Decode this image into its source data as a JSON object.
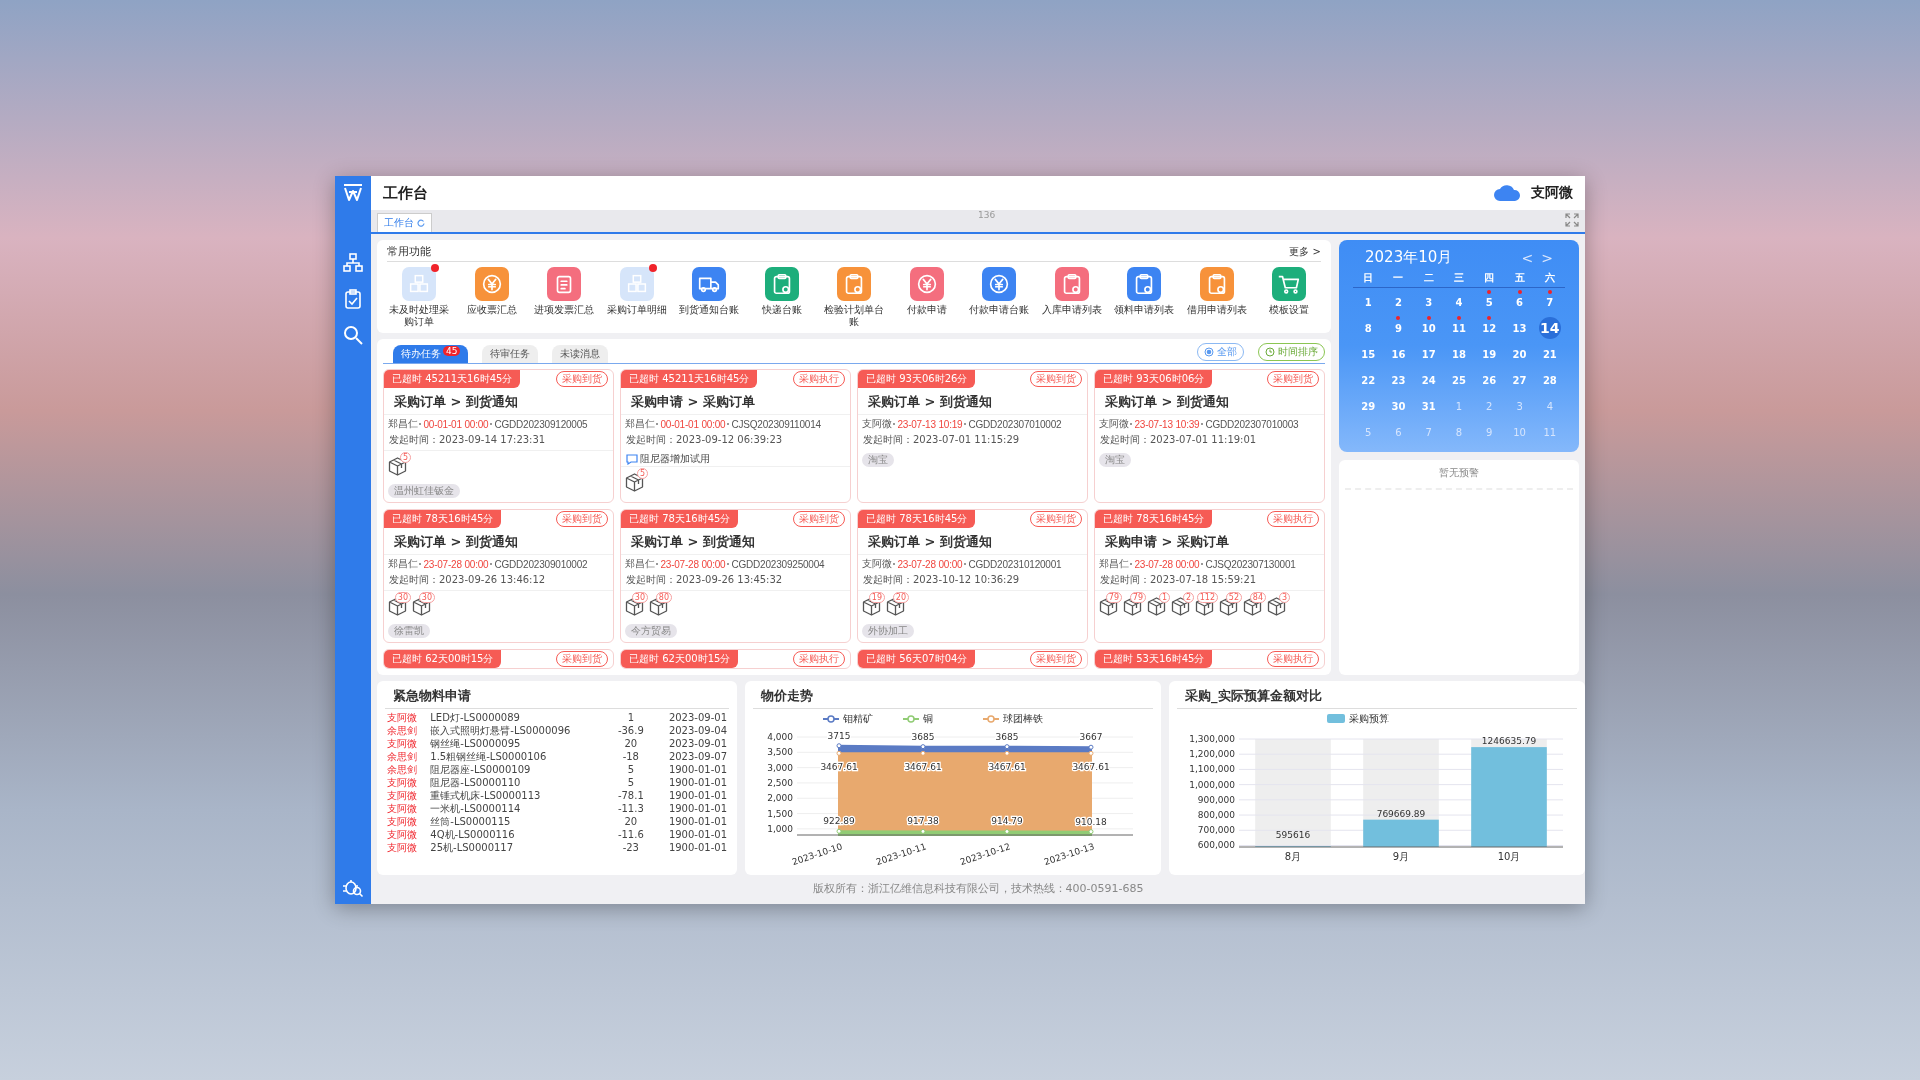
{
  "window": {
    "title": "工作台",
    "user": "支阿微"
  },
  "tab_strip": {
    "counter": "136",
    "tabs": [
      {
        "label": "工作台",
        "selected": true
      }
    ]
  },
  "functions": {
    "title": "常用功能",
    "more": "更多 >",
    "items": [
      {
        "label": "未及时处理采购订单",
        "kind": "boxes",
        "color": "#d6e5fa",
        "badge": true
      },
      {
        "label": "应收票汇总",
        "kind": "yen",
        "color": "#f7923a",
        "badge": false
      },
      {
        "label": "进项发票汇总",
        "kind": "doc",
        "color": "#f46e7e",
        "badge": false
      },
      {
        "label": "采购订单明细",
        "kind": "boxes",
        "color": "#d6e5fa",
        "badge": true
      },
      {
        "label": "到货通知台账",
        "kind": "truck",
        "color": "#3d84f2",
        "badge": false
      },
      {
        "label": "快递台账",
        "kind": "clipboard",
        "color": "#1dae7b",
        "badge": false
      },
      {
        "label": "检验计划单台账",
        "kind": "clipboard",
        "color": "#f7923a",
        "badge": false
      },
      {
        "label": "付款申请",
        "kind": "yen",
        "color": "#f46e7e",
        "badge": false
      },
      {
        "label": "付款申请台账",
        "kind": "yen",
        "color": "#3d84f2",
        "badge": false
      },
      {
        "label": "入库申请列表",
        "kind": "clipboard",
        "color": "#f46e7e",
        "badge": false
      },
      {
        "label": "领料申请列表",
        "kind": "clipboard",
        "color": "#3d84f2",
        "badge": false
      },
      {
        "label": "借用申请列表",
        "kind": "clipboard",
        "color": "#f7923a",
        "badge": false
      },
      {
        "label": "模板设置",
        "kind": "cart",
        "color": "#1dae7b",
        "badge": false
      }
    ]
  },
  "tasks": {
    "tabs": [
      {
        "label": "待办任务",
        "selected": true,
        "badge": "45"
      },
      {
        "label": "待审任务",
        "selected": false
      },
      {
        "label": "未读消息",
        "selected": false
      }
    ],
    "filters": [
      {
        "label": "全部",
        "kind": "radio"
      },
      {
        "label": "时间排序",
        "kind": "clock"
      }
    ],
    "cards": [
      {
        "timeout": "已超时 45211天16时45分",
        "tag": "采购到货",
        "flow": "采购订单 > 到货通知",
        "person": "郑昌仁",
        "due": "00-01-01 00:00",
        "code": "CGDD202309120005",
        "started": "发起时间：2023-09-14 17:23:31",
        "boxes": [
          "5"
        ],
        "supplier": "温州虹佳钣金"
      },
      {
        "timeout": "已超时 45211天16时45分",
        "tag": "采购执行",
        "flow": "采购申请 > 采购订单",
        "person": "郑昌仁",
        "due": "00-01-01 00:00",
        "code": "CJSQ202309110014",
        "started": "发起时间：2023-09-12 06:39:23",
        "note": "阻尼器增加试用",
        "boxes": [
          "5"
        ]
      },
      {
        "timeout": "已超时 93天06时26分",
        "tag": "采购到货",
        "flow": "采购订单 > 到货通知",
        "person": "支阿微",
        "due": "23-07-13 10:19",
        "code": "CGDD202307010002",
        "started": "发起时间：2023-07-01 11:15:29",
        "supplier": "淘宝"
      },
      {
        "timeout": "已超时 93天06时06分",
        "tag": "采购到货",
        "flow": "采购订单 > 到货通知",
        "person": "支阿微",
        "due": "23-07-13 10:39",
        "code": "CGDD202307010003",
        "started": "发起时间：2023-07-01 11:19:01",
        "supplier": "淘宝"
      },
      {
        "timeout": "已超时 78天16时45分",
        "tag": "采购到货",
        "flow": "采购订单 > 到货通知",
        "person": "郑昌仁",
        "due": "23-07-28 00:00",
        "code": "CGDD202309010002",
        "started": "发起时间：2023-09-26 13:46:12",
        "boxes": [
          "30",
          "30"
        ],
        "supplier": "徐雷凯"
      },
      {
        "timeout": "已超时 78天16时45分",
        "tag": "采购到货",
        "flow": "采购订单 > 到货通知",
        "person": "郑昌仁",
        "due": "23-07-28 00:00",
        "code": "CGDD202309250004",
        "started": "发起时间：2023-09-26 13:45:32",
        "boxes": [
          "30",
          "80"
        ],
        "supplier": "今方贸易"
      },
      {
        "timeout": "已超时 78天16时45分",
        "tag": "采购到货",
        "flow": "采购订单 > 到货通知",
        "person": "支阿微",
        "due": "23-07-28 00:00",
        "code": "CGDD202310120001",
        "started": "发起时间：2023-10-12 10:36:29",
        "boxes": [
          "19",
          "20"
        ],
        "supplier": "外协加工"
      },
      {
        "timeout": "已超时 78天16时45分",
        "tag": "采购执行",
        "flow": "采购申请 > 采购订单",
        "person": "郑昌仁",
        "due": "23-07-28 00:00",
        "code": "CJSQ202307130001",
        "started": "发起时间：2023-07-18 15:59:21",
        "boxes": [
          "79",
          "79",
          "1",
          "2",
          "112",
          "52",
          "84",
          "3"
        ]
      },
      {
        "timeout": "已超时 62天00时15分",
        "tag": "采购到货"
      },
      {
        "timeout": "已超时 62天00时15分",
        "tag": "采购执行"
      },
      {
        "timeout": "已超时 56天07时04分",
        "tag": "采购到货"
      },
      {
        "timeout": "已超时 53天16时45分",
        "tag": "采购执行"
      }
    ]
  },
  "calendar": {
    "title": "2023年10月",
    "prev": "<",
    "next": ">",
    "weekdays": [
      "日",
      "一",
      "二",
      "三",
      "四",
      "五",
      "六"
    ],
    "days": [
      {
        "day": "1",
        "other_month": false,
        "dot": false,
        "selected": false
      },
      {
        "day": "2",
        "other_month": false,
        "dot": false,
        "selected": false
      },
      {
        "day": "3",
        "other_month": false,
        "dot": false,
        "selected": false
      },
      {
        "day": "4",
        "other_month": false,
        "dot": false,
        "selected": false
      },
      {
        "day": "5",
        "other_month": false,
        "dot": true,
        "selected": false
      },
      {
        "day": "6",
        "other_month": false,
        "dot": true,
        "selected": false
      },
      {
        "day": "7",
        "other_month": false,
        "dot": true,
        "selected": false
      },
      {
        "day": "8",
        "other_month": false,
        "dot": false,
        "selected": false
      },
      {
        "day": "9",
        "other_month": false,
        "dot": true,
        "selected": false
      },
      {
        "day": "10",
        "other_month": false,
        "dot": true,
        "selected": false
      },
      {
        "day": "11",
        "other_month": false,
        "dot": true,
        "selected": false
      },
      {
        "day": "12",
        "other_month": false,
        "dot": true,
        "selected": false
      },
      {
        "day": "13",
        "other_month": false,
        "dot": false,
        "selected": false
      },
      {
        "day": "14",
        "other_month": false,
        "dot": false,
        "selected": true
      },
      {
        "day": "15",
        "other_month": false,
        "dot": false,
        "selected": false
      },
      {
        "day": "16",
        "other_month": false,
        "dot": false,
        "selected": false
      },
      {
        "day": "17",
        "other_month": false,
        "dot": false,
        "selected": false
      },
      {
        "day": "18",
        "other_month": false,
        "dot": false,
        "selected": false
      },
      {
        "day": "19",
        "other_month": false,
        "dot": false,
        "selected": false
      },
      {
        "day": "20",
        "other_month": false,
        "dot": false,
        "selected": false
      },
      {
        "day": "21",
        "other_month": false,
        "dot": false,
        "selected": false
      },
      {
        "day": "22",
        "other_month": false,
        "dot": false,
        "selected": false
      },
      {
        "day": "23",
        "other_month": false,
        "dot": false,
        "selected": false
      },
      {
        "day": "24",
        "other_month": false,
        "dot": false,
        "selected": false
      },
      {
        "day": "25",
        "other_month": false,
        "dot": false,
        "selected": false
      },
      {
        "day": "26",
        "other_month": false,
        "dot": false,
        "selected": false
      },
      {
        "day": "27",
        "other_month": false,
        "dot": false,
        "selected": false
      },
      {
        "day": "28",
        "other_month": false,
        "dot": false,
        "selected": false
      },
      {
        "day": "29",
        "other_month": false,
        "dot": false,
        "selected": false
      },
      {
        "day": "30",
        "other_month": false,
        "dot": false,
        "selected": false
      },
      {
        "day": "31",
        "other_month": false,
        "dot": false,
        "selected": false
      },
      {
        "day": "1",
        "other_month": true,
        "dot": false,
        "selected": false
      },
      {
        "day": "2",
        "other_month": true,
        "dot": false,
        "selected": false
      },
      {
        "day": "3",
        "other_month": true,
        "dot": false,
        "selected": false
      },
      {
        "day": "4",
        "other_month": true,
        "dot": false,
        "selected": false
      },
      {
        "day": "5",
        "other_month": true,
        "dot": false,
        "selected": false
      },
      {
        "day": "6",
        "other_month": true,
        "dot": false,
        "selected": false
      },
      {
        "day": "7",
        "other_month": true,
        "dot": false,
        "selected": false
      },
      {
        "day": "8",
        "other_month": true,
        "dot": false,
        "selected": false
      },
      {
        "day": "9",
        "other_month": true,
        "dot": false,
        "selected": false
      },
      {
        "day": "10",
        "other_month": true,
        "dot": false,
        "selected": false
      },
      {
        "day": "11",
        "other_month": true,
        "dot": false,
        "selected": false
      }
    ]
  },
  "warnings": {
    "empty_text": "暂无预警"
  },
  "urgent": {
    "title": "紧急物料申请",
    "rows": [
      {
        "name": "支阿微",
        "material": "LED灯-LS0000089",
        "qty": "1",
        "date": "2023-09-01"
      },
      {
        "name": "余思剑",
        "material": "嵌入式照明灯悬臂-LS0000096",
        "qty": "-36.9",
        "date": "2023-09-04"
      },
      {
        "name": "支阿微",
        "material": "钢丝绳-LS0000095",
        "qty": "20",
        "date": "2023-09-01"
      },
      {
        "name": "余思剑",
        "material": "1.5粗钢丝绳-LS0000106",
        "qty": "-18",
        "date": "2023-09-07"
      },
      {
        "name": "余思剑",
        "material": "阻尼器座-LS0000109",
        "qty": "5",
        "date": "1900-01-01"
      },
      {
        "name": "支阿微",
        "material": "阻尼器-LS0000110",
        "qty": "5",
        "date": "1900-01-01"
      },
      {
        "name": "支阿微",
        "material": "重锤式机床-LS0000113",
        "qty": "-78.1",
        "date": "1900-01-01"
      },
      {
        "name": "支阿微",
        "material": "一米机-LS0000114",
        "qty": "-11.3",
        "date": "1900-01-01"
      },
      {
        "name": "支阿微",
        "material": "丝筒-LS0000115",
        "qty": "20",
        "date": "1900-01-01"
      },
      {
        "name": "支阿微",
        "material": "4Q机-LS0000116",
        "qty": "-11.6",
        "date": "1900-01-01"
      },
      {
        "name": "支阿微",
        "material": "25机-LS0000117",
        "qty": "-23",
        "date": "1900-01-01"
      }
    ]
  },
  "price_trend": {
    "title": "物价走势",
    "chart_data": {
      "type": "area",
      "grid": true,
      "legend": true,
      "categories": [
        "2023-10-10",
        "2023-10-11",
        "2023-10-12",
        "2023-10-13"
      ],
      "ylim": [
        800,
        4000
      ],
      "yticks": [
        {
          "value": 1000,
          "label": "1,000"
        },
        {
          "value": 1500,
          "label": "1,500"
        },
        {
          "value": 2000,
          "label": "2,000"
        },
        {
          "value": 2500,
          "label": "2,500"
        },
        {
          "value": 3000,
          "label": "3,000"
        },
        {
          "value": 3500,
          "label": "3,500"
        },
        {
          "value": 4000,
          "label": "4,000"
        }
      ],
      "data_labels": true,
      "series": [
        {
          "name": "钼精矿",
          "color": "#5b7bc4",
          "values": [
            3715,
            3685,
            3685,
            3667
          ]
        },
        {
          "name": "铜",
          "color": "#91cc75",
          "values": [
            922.89,
            917.38,
            914.79,
            910.18
          ]
        },
        {
          "name": "球团棒铁",
          "color": "#e8a96e",
          "values": [
            3467.61,
            3467.61,
            3467.61,
            3467.61
          ]
        }
      ]
    }
  },
  "budget": {
    "title": "采购_实际预算金额对比",
    "chart_data": {
      "type": "bar",
      "grid": true,
      "legend": true,
      "categories": [
        "8月",
        "9月",
        "10月"
      ],
      "ylim": [
        590000,
        1300000
      ],
      "yticks": [
        {
          "value": 600000,
          "label": "600,000"
        },
        {
          "value": 700000,
          "label": "700,000"
        },
        {
          "value": 800000,
          "label": "800,000"
        },
        {
          "value": 900000,
          "label": "900,000"
        },
        {
          "value": 1000000,
          "label": "1,000,000"
        },
        {
          "value": 1100000,
          "label": "1,100,000"
        },
        {
          "value": 1200000,
          "label": "1,200,000"
        },
        {
          "value": 1300000,
          "label": "1,300,000"
        }
      ],
      "data_labels": true,
      "series": [
        {
          "name": "采购预算",
          "color": "#72bfdd",
          "values": [
            595616,
            769669.89,
            1246635.79
          ]
        }
      ]
    }
  },
  "footer": "版权所有：浙江亿维信息科技有限公司，技术热线：400-0591-685"
}
